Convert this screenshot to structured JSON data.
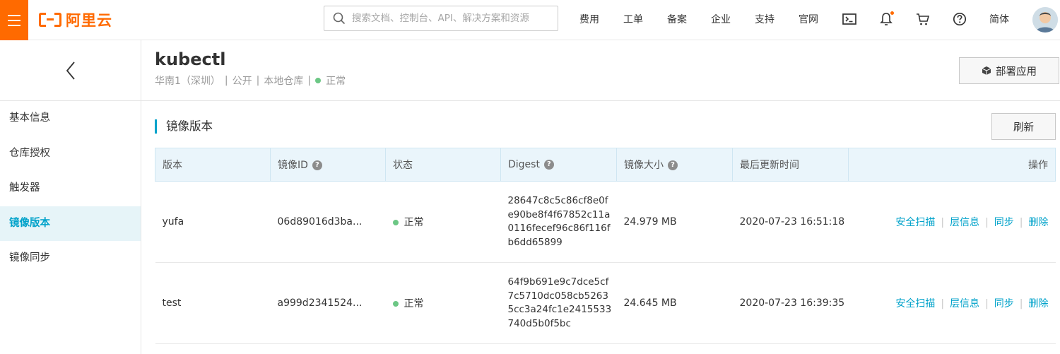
{
  "brand": {
    "logo_text": "阿里云",
    "accent": "#ff6a00"
  },
  "search": {
    "placeholder": "搜索文档、控制台、API、解决方案和资源"
  },
  "topnav": {
    "items": [
      "费用",
      "工单",
      "备案",
      "企业",
      "支持",
      "官网"
    ],
    "lang": "简体",
    "icons": [
      "terminal-icon",
      "bell-icon",
      "cart-icon",
      "help-icon"
    ]
  },
  "sidebar": {
    "back_icon": "chevron-left-icon",
    "items": [
      {
        "label": "基本信息",
        "active": false
      },
      {
        "label": "仓库授权",
        "active": false
      },
      {
        "label": "触发器",
        "active": false
      },
      {
        "label": "镜像版本",
        "active": true
      },
      {
        "label": "镜像同步",
        "active": false
      }
    ]
  },
  "repo": {
    "name": "kubectl",
    "region": "华南1（深圳）",
    "visibility": "公开",
    "source": "本地仓库",
    "status": "正常",
    "deploy_label": "部署应用"
  },
  "section": {
    "title": "镜像版本",
    "refresh_label": "刷新"
  },
  "table": {
    "columns": [
      "版本",
      "镜像ID",
      "状态",
      "Digest",
      "镜像大小",
      "最后更新时间",
      "操作"
    ],
    "help_mark": "?",
    "rows": [
      {
        "version": "yufa",
        "image_id": "06d89016d3ba...",
        "status": "正常",
        "digest": "28647c8c5c86cf8e0fe90be8f4f67852c11a0116fecef96c86f116fb6dd65899",
        "size": "24.979 MB",
        "updated": "2020-07-23 16:51:18",
        "actions": [
          "安全扫描",
          "层信息",
          "同步",
          "删除"
        ]
      },
      {
        "version": "test",
        "image_id": "a999d2341524...",
        "status": "正常",
        "digest": "64f9b691e9c7dce5cf7c5710dc058cb52635cc3a24fc1e2415533740d5b0f5bc",
        "size": "24.645 MB",
        "updated": "2020-07-23 16:39:35",
        "actions": [
          "安全扫描",
          "层信息",
          "同步",
          "删除"
        ]
      }
    ]
  },
  "colors": {
    "link": "#00a2ca",
    "status_ok": "#6cc785",
    "header_bg": "#eaf5fb"
  }
}
